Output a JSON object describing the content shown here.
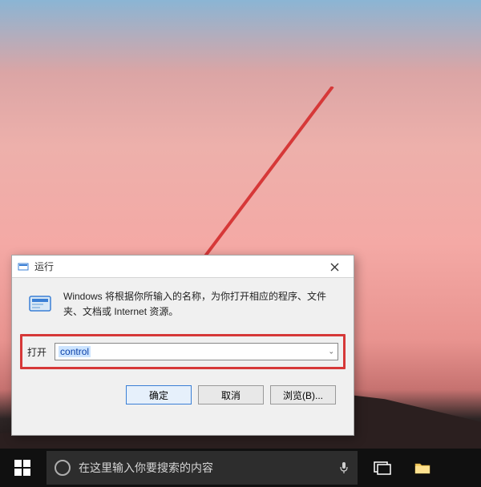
{
  "dialog": {
    "title": "运行",
    "description": "Windows 将根据你所输入的名称，为你打开相应的程序、文件夹、文档或 Internet 资源。",
    "open_label": "打开",
    "input_value": "control",
    "buttons": {
      "ok": "确定",
      "cancel": "取消",
      "browse": "浏览(B)..."
    }
  },
  "taskbar": {
    "search_placeholder": "在这里输入你要搜索的内容"
  },
  "annotation": {
    "highlight_color": "#d63838"
  }
}
